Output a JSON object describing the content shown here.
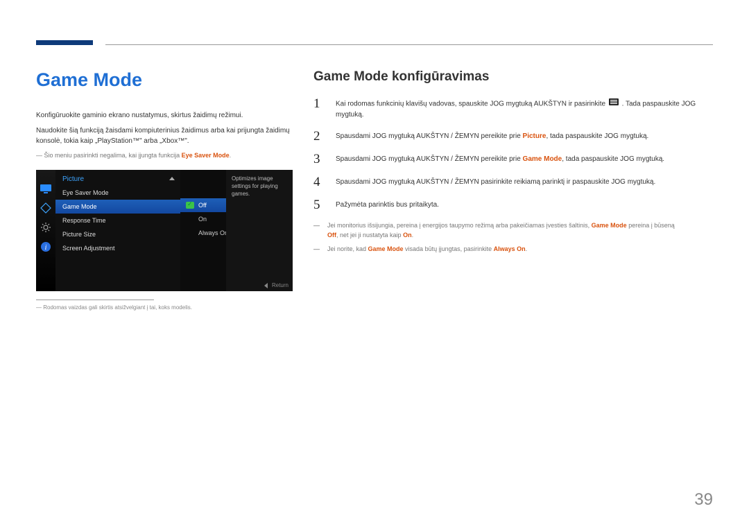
{
  "page_number": "39",
  "left": {
    "title": "Game Mode",
    "para1": "Konfigūruokite gaminio ekrano nustatymus, skirtus žaidimų režimui.",
    "para2": "Naudokite šią funkciją žaisdami kompiuterinius žaidimus arba kai prijungta žaidimų konsolė, tokia kaip „PlayStation™\" arba „Xbox™\".",
    "note1_prefix": "― Šio meniu pasirinkti negalima, kai įjungta funkcija ",
    "note1_highlight": "Eye Saver Mode",
    "note1_suffix": ".",
    "footnote": "― Rodomas vaizdas gali skirtis atsižvelgiant į tai, koks modelis."
  },
  "osd": {
    "header": "Picture",
    "items": [
      "Eye Saver Mode",
      "Game Mode",
      "Response Time",
      "Picture Size",
      "Screen Adjustment"
    ],
    "selected_item_index": 1,
    "options": [
      "Off",
      "On",
      "Always On"
    ],
    "selected_option_index": 0,
    "help_text": "Optimizes image settings for playing games.",
    "return_label": "Return",
    "icons": [
      "monitor-icon",
      "diamond-icon",
      "gear-icon",
      "info-icon"
    ]
  },
  "right": {
    "title": "Game Mode konfigūravimas",
    "steps": [
      {
        "n": "1",
        "pre": "Kai rodomas funkcinių klavišų vadovas, spauskite JOG mygtuką AUKŠTYN ir pasirinkite ",
        "post": ". Tada paspauskite JOG mygtuką."
      },
      {
        "n": "2",
        "pre": "Spausdami JOG mygtuką AUKŠTYN / ŽEMYN pereikite prie ",
        "hl": "Picture",
        "suf": ", tada paspauskite JOG mygtuką."
      },
      {
        "n": "3",
        "pre": "Spausdami JOG mygtuką AUKŠTYN / ŽEMYN pereikite prie ",
        "hl": "Game Mode",
        "suf": ", tada paspauskite JOG mygtuką."
      },
      {
        "n": "4",
        "text": "Spausdami JOG mygtuką AUKŠTYN / ŽEMYN pasirinkite reikiamą parinktį ir paspauskite JOG mygtuką."
      },
      {
        "n": "5",
        "text": "Pažymėta parinktis bus pritaikyta."
      }
    ],
    "notes": [
      {
        "pre": "Jei monitorius išsijungia, pereina į energijos taupymo režimą arba pakeičiamas įvesties šaltinis, ",
        "hl1": "Game Mode",
        "mid": " pereina į būseną ",
        "hl2": "Off",
        "suf1": ", net jei ji nustatyta kaip ",
        "hl3": "On",
        "suf2": "."
      },
      {
        "pre": "Jei norite, kad ",
        "hl1": "Game Mode",
        "mid": " visada būtų įjungtas, pasirinkite ",
        "hl2": "Always On",
        "suf": "."
      }
    ]
  }
}
